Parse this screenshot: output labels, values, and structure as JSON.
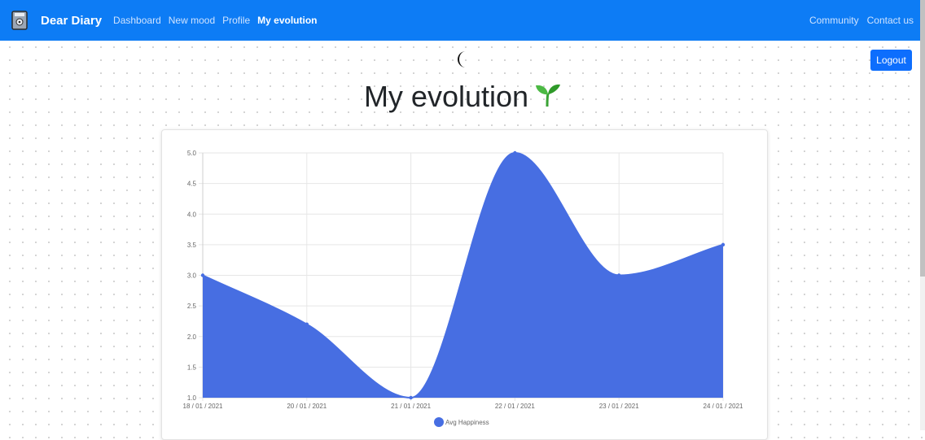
{
  "navbar": {
    "brand": "Dear Diary",
    "brand_icon": "diary-icon",
    "links": [
      "Dashboard",
      "New mood",
      "Profile",
      "My evolution"
    ],
    "active": "My evolution",
    "right_links": [
      "Community",
      "Contact us"
    ],
    "color": "#0d7cf5"
  },
  "header": {
    "theme_icon": "moon-icon",
    "title": "My evolution",
    "title_icon": "sprout-icon",
    "logout_label": "Logout"
  },
  "chart_data": {
    "type": "area",
    "x": [
      "18 / 01 / 2021",
      "20 / 01 / 2021",
      "21 / 01 / 2021",
      "22 / 01 / 2021",
      "23 / 01 / 2021",
      "24 / 01 / 2021"
    ],
    "series": [
      {
        "name": "Avg Happiness",
        "values": [
          3.0,
          2.2,
          1.0,
          5.0,
          3.0,
          3.5
        ],
        "color": "#476ee2"
      }
    ],
    "ylim": [
      1.0,
      5.0
    ],
    "yticks": [
      "1.0",
      "1.5",
      "2.0",
      "2.5",
      "3.0",
      "3.5",
      "4.0",
      "4.5",
      "5.0"
    ],
    "grid": true,
    "legend": "bottom"
  }
}
